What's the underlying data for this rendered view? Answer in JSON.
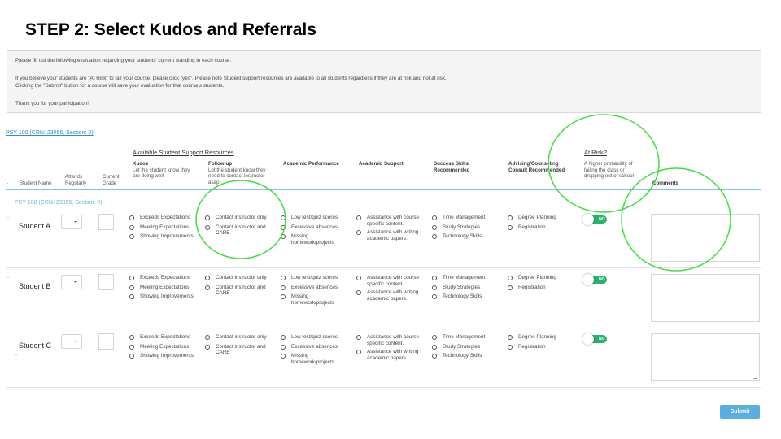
{
  "slide_title": "STEP 2: Select Kudos and Referrals",
  "info": {
    "line1": "Please fill out the following evaluation regarding your students' current standing in each course.",
    "line2": "If you believe your students are \"At Risk\" to fail your course, please click \"yes\". Please note Student support resources are available to all students regardless if they are at risk and not at risk.",
    "line3": "Clicking the \"Submit\" button for a course will save your evaluation for that course's students.",
    "line4": "Thank you for your participation!"
  },
  "course_link": "PSY 100 (CRN: 23056, Section: 0)",
  "sub_course": "PSY 100 (CRN: 23056, Section: 0)",
  "headers": {
    "resources_title": "Available Student Support Resources",
    "at_risk_title": "At Risk?",
    "student_name": "Student Name",
    "attends_1": "Attends",
    "attends_2": "Regularly",
    "grade_1": "Current",
    "grade_2": "Grade",
    "kudos_title": "Kudos",
    "kudos_desc_1": "Let the student know they",
    "kudos_desc_2": "are doing well",
    "followup_title": "Follow-up",
    "followup_desc_1": "Let the student know they",
    "followup_desc_2": "need to contact instructor",
    "followup_desc_3": "asap",
    "academic_perf": "Academic Performance",
    "academic_support": "Academic Support",
    "success_1": "Success Skills",
    "success_2": "Recommended",
    "advising_1": "Advising/Counseling",
    "advising_2": "Consult Recommended",
    "risk_desc_1": "A higher probability of",
    "risk_desc_2": "failing the class or",
    "risk_desc_3": "dropping out of school",
    "comments": "Comments",
    "dash": "-"
  },
  "options": {
    "kudos": [
      "Exceeds Expectations",
      "Meeting Expectations",
      "Showing Improvements"
    ],
    "followup": [
      "Contact instructor only",
      "Contact instructor and",
      "CARE"
    ],
    "performance": [
      "Low test/quiz scores",
      "Excessive absences",
      "Missing",
      "homework/projects"
    ],
    "support": [
      "Assistance with course",
      "specific content.",
      "Assistance with writing",
      "academic papers."
    ],
    "skills": [
      "Time Management",
      "Study Strategies",
      "Technology Skills"
    ],
    "advising": [
      "Degree Planning",
      "Registration"
    ]
  },
  "toggle_label": "NO",
  "students": [
    {
      "name": "Student A",
      "at_risk": "NO"
    },
    {
      "name": "Student B",
      "at_risk": "NO"
    },
    {
      "name": "Student C",
      "at_risk": "NO"
    }
  ],
  "submit_label": "Submit",
  "colors": {
    "accent": "#5aaee0",
    "toggle_on": "#27b36b",
    "annotation": "#3ee03e"
  }
}
